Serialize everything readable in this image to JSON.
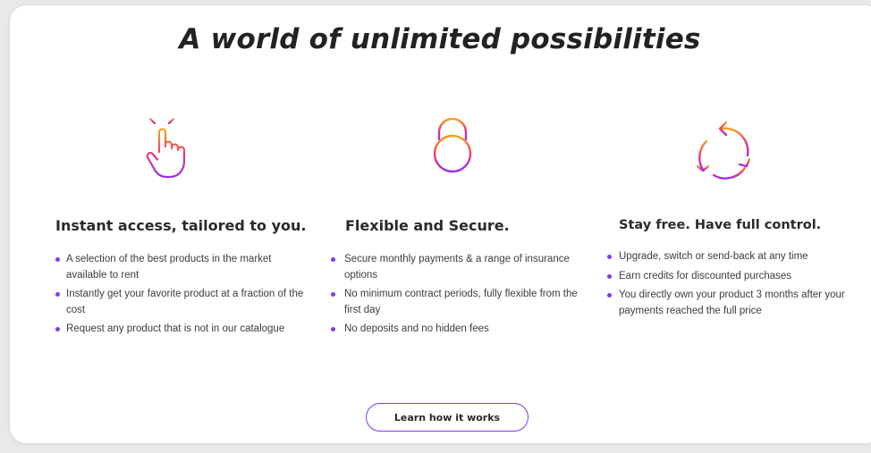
{
  "page": {
    "title": "A world of unlimited possibilities"
  },
  "colors": {
    "accent": "#7b3cf0",
    "gradient_start": "#f7a21b",
    "gradient_mid": "#ef3a6c",
    "gradient_end": "#9b2ff0",
    "bullet": "#7b3cf0"
  },
  "features": [
    {
      "icon": "tap-hand-icon",
      "title": "Instant access, tailored to you.",
      "points": [
        "A selection of the best products in the market available to rent",
        "Instantly get your favorite product at a fraction of the cost",
        "Request any product that is not in our catalogue"
      ]
    },
    {
      "icon": "padlock-icon",
      "title": "Flexible and Secure.",
      "points": [
        "Secure monthly payments & a range of insurance options",
        "No minimum contract periods, fully flexible from the first day",
        "No deposits and no hidden fees"
      ]
    },
    {
      "icon": "refresh-cycle-icon",
      "title": "Stay free. Have full control.",
      "points": [
        "Upgrade, switch or send-back at any time",
        "Earn credits for discounted purchases",
        "You directly own your product 3 months after your payments reached the full price"
      ]
    }
  ],
  "cta": {
    "label": "Learn how it works"
  }
}
